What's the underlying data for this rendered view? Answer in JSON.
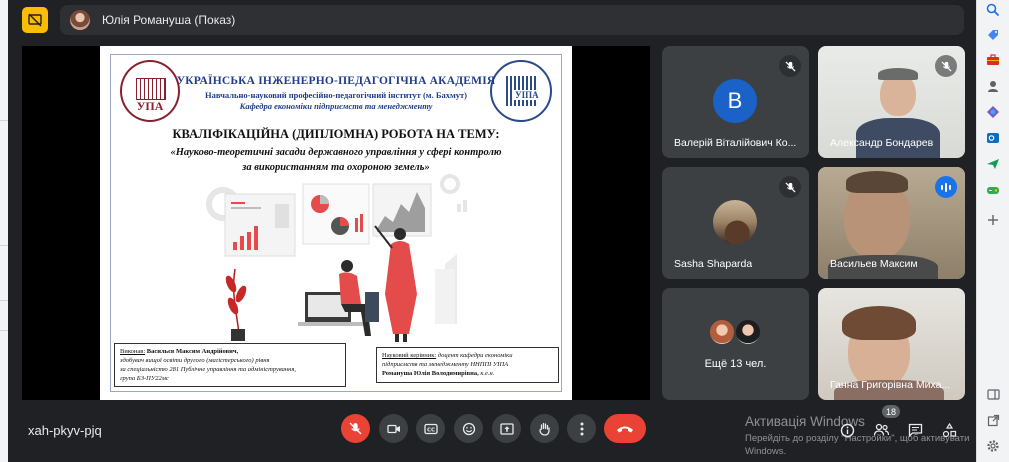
{
  "presenter": {
    "name": "Юлія Романуша (Показ)"
  },
  "slide": {
    "academy": "УКРАЇНСЬКА ІНЖЕНЕРНО-ПЕДАГОГІЧНА АКАДЕМІЯ",
    "institute": "Навчально-науковий професійно-педагогічний інститут (м. Бахмут)",
    "department": "Кафедра економіки підприємств та менеджменту",
    "title": "КВАЛІФІКАЦІЙНА (ДИПЛОМНА) РОБОТА НА ТЕМУ:",
    "topic_line1": "«Науково-теоретичні засади державного управління у сфері контролю",
    "topic_line2": "за використанням та охороною земель»",
    "logo_left_text": "УПА",
    "logo_right_text": "УІПА",
    "author_label": "Виконав:",
    "author_name": "Васильєв Максим Андрійович,",
    "author_line2": "здобувач вищої освіти другого (магістерського) рівня",
    "author_line3": "за спеціальністю 281 Публічне управління та адміністрування,",
    "author_line4": "група БЗ-ПУ22мс",
    "supervisor_label": "Науковий керівник:",
    "supervisor_line1": "доцент кафедри економіки",
    "supervisor_line2": "підприємств та менеджменту ННППІ УІПА",
    "supervisor_name": "Романуша Юлія Володимирівна,",
    "supervisor_degree": "к.е.н."
  },
  "participants": [
    {
      "name": "Валерій Віталійович Ко...",
      "initial": "В",
      "muted": true
    },
    {
      "name": "Александр Бондарев",
      "muted": true
    },
    {
      "name": "Sasha Shaparda",
      "muted": true
    },
    {
      "name": "Васильев Максим",
      "speaking": true
    },
    {
      "more_label": "Ещё 13 чел."
    },
    {
      "name": "Ганна Григорівна Миха..."
    }
  ],
  "meeting": {
    "code": "xah-pkyv-pjq",
    "participant_count": "18"
  },
  "watermark": {
    "line1": "Активація Windows",
    "line2": "Перейдіть до розділу \"Настройки\", щоб активувати",
    "line3": "Windows."
  },
  "colors": {
    "background": "#202124",
    "tile": "#3c4043",
    "danger": "#ea4335",
    "presenting": "#fbbc04",
    "accent": "#8ab4f8"
  }
}
